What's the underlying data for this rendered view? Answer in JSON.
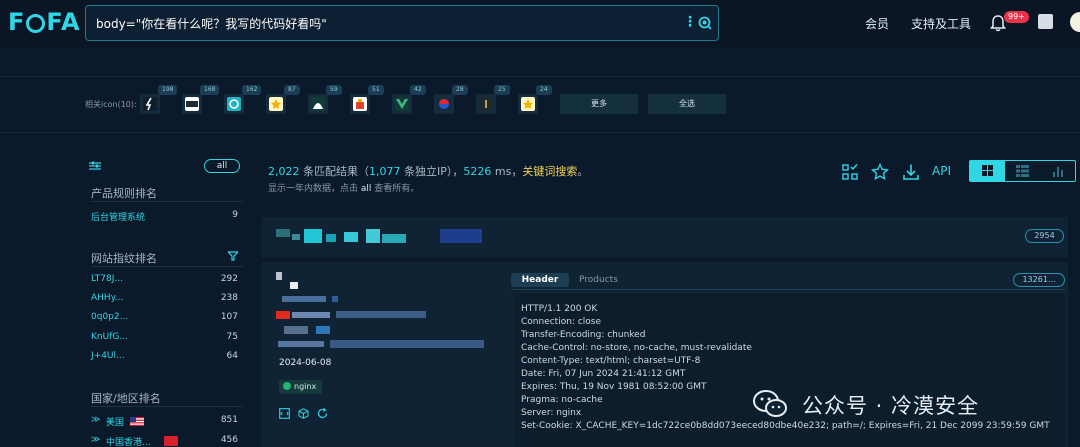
{
  "header": {
    "logo": "FOFA",
    "search_value": "body=\"你在看什么呢？我写的代码好看吗\"",
    "nav": [
      "会员",
      "支持及工具"
    ],
    "notification_badge": "99+"
  },
  "icons_strip": {
    "label": "相关icon(10):",
    "counts": [
      "198",
      "168",
      "162",
      "87",
      "59",
      "51",
      "42",
      "28",
      "25",
      "24"
    ],
    "more_button": "更多",
    "select_all_button": "全选"
  },
  "sidebar": {
    "all_label": "all",
    "product_title": "产品规则排名",
    "products": [
      {
        "label": "后台管理系统",
        "count": "9"
      }
    ],
    "fingerprint_title": "网站指纹排名",
    "fingerprints": [
      {
        "label": "LT78J...",
        "count": "292"
      },
      {
        "label": "AHHy...",
        "count": "238"
      },
      {
        "label": "0q0p2...",
        "count": "107"
      },
      {
        "label": "KnUfG...",
        "count": "75"
      },
      {
        "label": "J+4Ul...",
        "count": "64"
      }
    ],
    "region_title": "国家/地区排名",
    "regions": [
      {
        "label": "美国",
        "count": "851"
      },
      {
        "label": "中国香港...",
        "count": "456"
      }
    ]
  },
  "results": {
    "count": "2,022",
    "text_match": " 条匹配结果（",
    "ip_count": "1,077",
    "text_ip": " 条独立IP），",
    "time": "5226",
    "text_ms": " ms，",
    "keyword_link": "关键词搜索",
    "period": "。",
    "sub_text_1": "显示一年内数据，点击 ",
    "sub_link": "all",
    "sub_text_2": " 查看所有。",
    "api_label": "API"
  },
  "card": {
    "header_count": "2954",
    "date": "2024-06-08",
    "tech_tag": "nginx",
    "tabs": [
      "Header",
      "Products"
    ],
    "cert_pill": "13261...",
    "http_lines": [
      "HTTP/1.1 200 OK",
      "Connection: close",
      "Transfer-Encoding: chunked",
      "Cache-Control: no-store, no-cache, must-revalidate",
      "Content-Type: text/html; charset=UTF-8",
      "Date: Fri, 07 Jun 2024 21:41:12 GMT",
      "Expires: Thu, 19 Nov 1981 08:52:00 GMT",
      "Pragma: no-cache",
      "Server: nginx",
      "Set-Cookie: X_CACHE_KEY=1dc722ce0b8dd073eeced80dbe40e232; path=/; Expires=Fri, 21 Dec 2099 23:59:59 GMT"
    ]
  },
  "watermark": "公众号 · 冷漠安全",
  "colors": {
    "accent": "#2fd6e6",
    "highlight": "#f5d24b",
    "badge": "#e8334a",
    "background": "#0b1a2b"
  }
}
